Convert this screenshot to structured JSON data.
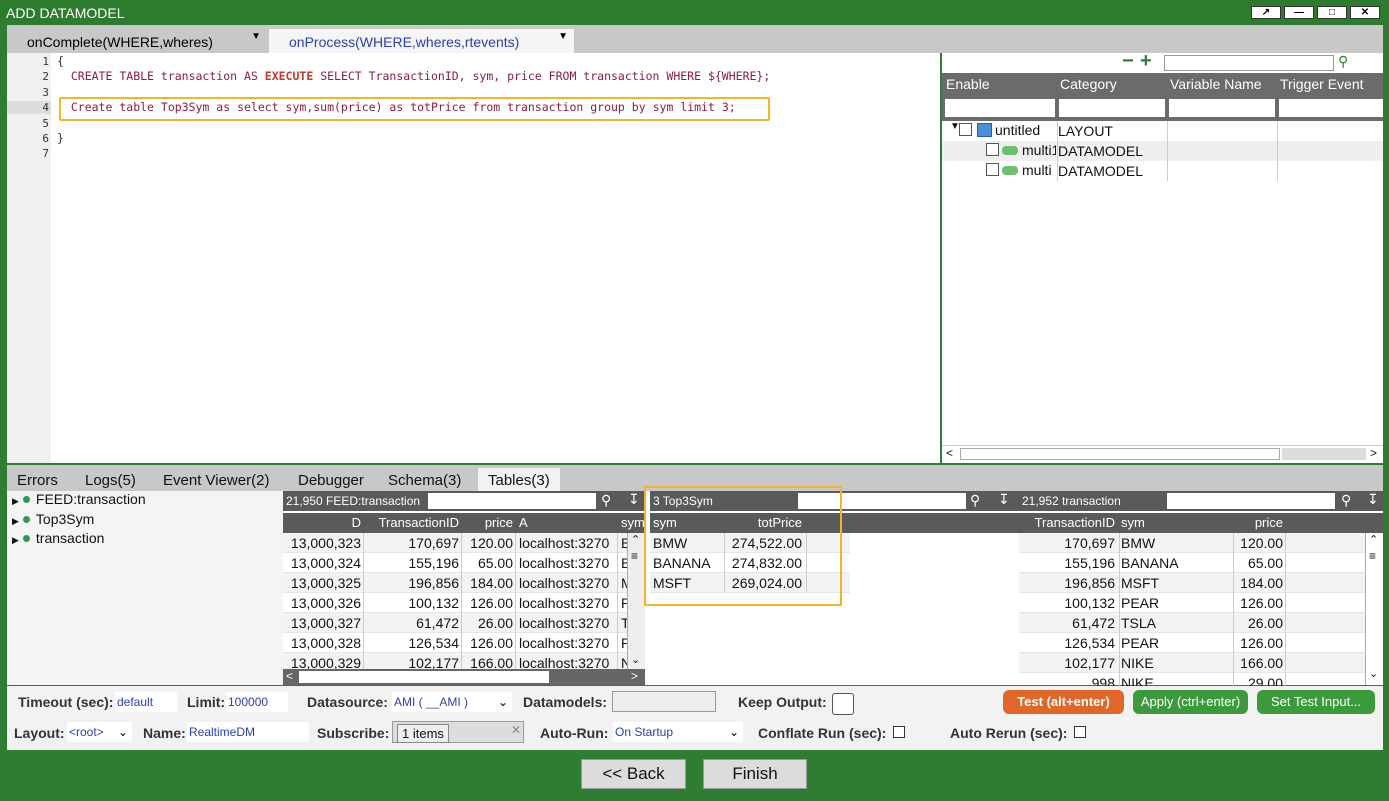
{
  "window": {
    "title": "ADD DATAMODEL"
  },
  "tabs": [
    {
      "label": "onComplete(WHERE,wheres)"
    },
    {
      "label": "onProcess(WHERE,wheres,rtevents)"
    }
  ],
  "editor": {
    "line_numbers": [
      "1",
      "2",
      "3",
      "4",
      "5",
      "6",
      "7"
    ],
    "lines": [
      "{",
      "  CREATE TABLE transaction AS EXECUTE SELECT TransactionID, sym, price FROM transaction WHERE ${WHERE};",
      "",
      "  Create table Top3Sym as select sym,sum(price) as totPrice from transaction group by sym limit 3;",
      "",
      "}",
      ""
    ]
  },
  "variables": {
    "columns": [
      "Enable",
      "Category",
      "Variable Name",
      "Trigger Event"
    ],
    "rows": [
      {
        "name": "untitled",
        "category": "LAYOUT"
      },
      {
        "name": "multi1",
        "category": "DATAMODEL"
      },
      {
        "name": "multi",
        "category": "DATAMODEL"
      }
    ]
  },
  "bottom_tabs": [
    "Errors",
    "Logs(5)",
    "Event Viewer(2)",
    "Debugger",
    "Schema(3)",
    "Tables(3)"
  ],
  "tables_tree": [
    "FEED:transaction",
    "Top3Sym",
    "transaction"
  ],
  "feed_pane": {
    "title": "21,950 FEED:transaction",
    "columns": [
      "D",
      "TransactionID",
      "price",
      "A",
      "sym"
    ],
    "rows": [
      [
        "13,000,323",
        "170,697",
        "120.00",
        "localhost:3270",
        "B"
      ],
      [
        "13,000,324",
        "155,196",
        "65.00",
        "localhost:3270",
        "B"
      ],
      [
        "13,000,325",
        "196,856",
        "184.00",
        "localhost:3270",
        "M"
      ],
      [
        "13,000,326",
        "100,132",
        "126.00",
        "localhost:3270",
        "P"
      ],
      [
        "13,000,327",
        "61,472",
        "26.00",
        "localhost:3270",
        "T"
      ],
      [
        "13,000,328",
        "126,534",
        "126.00",
        "localhost:3270",
        "P"
      ],
      [
        "13,000,329",
        "102,177",
        "166.00",
        "localhost:3270",
        "N"
      ]
    ]
  },
  "top3_pane": {
    "title": "3 Top3Sym",
    "columns": [
      "sym",
      "totPrice"
    ],
    "rows": [
      [
        "BMW",
        "274,522.00"
      ],
      [
        "BANANA",
        "274,832.00"
      ],
      [
        "MSFT",
        "269,024.00"
      ]
    ]
  },
  "trans_pane": {
    "title": "21,952 transaction",
    "columns": [
      "TransactionID",
      "sym",
      "price"
    ],
    "rows": [
      [
        "170,697",
        "BMW",
        "120.00"
      ],
      [
        "155,196",
        "BANANA",
        "65.00"
      ],
      [
        "196,856",
        "MSFT",
        "184.00"
      ],
      [
        "100,132",
        "PEAR",
        "126.00"
      ],
      [
        "61,472",
        "TSLA",
        "26.00"
      ],
      [
        "126,534",
        "PEAR",
        "126.00"
      ],
      [
        "102,177",
        "NIKE",
        "166.00"
      ],
      [
        "998",
        "NIKE",
        "29.00"
      ]
    ]
  },
  "controls": {
    "timeout_label": "Timeout (sec):",
    "timeout": "default",
    "limit_label": "Limit:",
    "limit": "100000",
    "datasource_label": "Datasource:",
    "datasource": "AMI ( __AMI )",
    "datamodels_label": "Datamodels:",
    "keep_output_label": "Keep Output:",
    "test_button": "Test (alt+enter)",
    "apply_button": "Apply (ctrl+enter)",
    "set_test_input_button": "Set Test Input...",
    "layout_label": "Layout:",
    "layout": "<root>",
    "name_label": "Name:",
    "name": "RealtimeDM",
    "subscribe_label": "Subscribe:",
    "subscribe": "1 items",
    "autorun_label": "Auto-Run:",
    "autorun": "On Startup",
    "conflate_label": "Conflate Run (sec):",
    "autorerun_label": "Auto Rerun (sec):"
  },
  "footer": {
    "back": "<< Back",
    "finish": "Finish"
  },
  "colors": {
    "frame": "#2e7d32",
    "highlight": "#f5b325",
    "test_button": "#e0662a",
    "apply_button": "#3c9a3c"
  }
}
